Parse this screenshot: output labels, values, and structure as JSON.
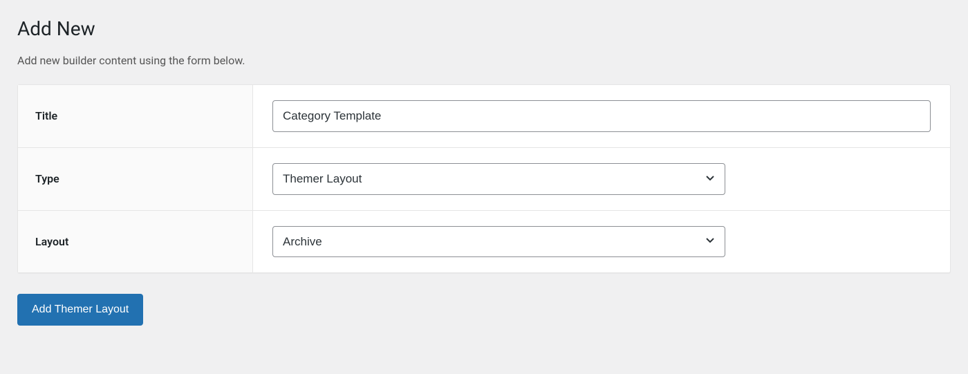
{
  "header": {
    "title": "Add New",
    "description": "Add new builder content using the form below."
  },
  "form": {
    "title": {
      "label": "Title",
      "value": "Category Template"
    },
    "type": {
      "label": "Type",
      "value": "Themer Layout"
    },
    "layout": {
      "label": "Layout",
      "value": "Archive"
    }
  },
  "submit": {
    "label": "Add Themer Layout"
  }
}
